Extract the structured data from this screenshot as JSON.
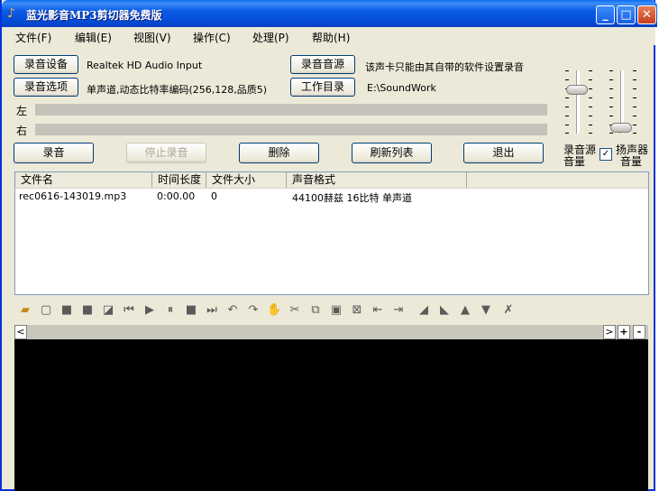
{
  "window": {
    "title": "蓝光影音MP3剪切器免费版",
    "controls": {
      "minimize": "_",
      "maximize": "□",
      "close": "✕"
    }
  },
  "menu": [
    "文件(F)",
    "编辑(E)",
    "视图(V)",
    "操作(C)",
    "处理(P)",
    "帮助(H)"
  ],
  "record_panel": {
    "device_button": "录音设备",
    "device_value": "Realtek HD Audio Input",
    "options_button": "录音选项",
    "options_value": "单声道,动态比特率编码(256,128,品质5)",
    "source_button": "录音音源",
    "source_value": "该声卡只能由其自带的软件设置录音",
    "workdir_button": "工作目录",
    "workdir_value": "E:\\SoundWork",
    "left_label": "左",
    "right_label": "右"
  },
  "actions": {
    "record": "录音",
    "stop": "停止录音",
    "delete": "删除",
    "refresh": "刷新列表",
    "exit": "退出"
  },
  "volume": {
    "source_label_1": "录音源",
    "source_label_2": "音量",
    "speaker_label_1": "扬声器",
    "speaker_label_2": "音量",
    "speaker_checked": "✓",
    "source_level": 0.7,
    "speaker_level": 0.1
  },
  "file_list": {
    "columns": [
      "文件名",
      "时间长度",
      "文件大小",
      "声音格式"
    ],
    "rows": [
      {
        "name": "rec0616-143019.mp3",
        "duration": "0:00.00",
        "size": "0",
        "format": "44100赫兹 16比特 单声道"
      }
    ]
  },
  "toolbar_icons": [
    "open-folder-icon",
    "new-file-icon",
    "save-icon",
    "save-as-icon",
    "export-icon",
    "skip-start-icon",
    "play-icon",
    "pause-icon",
    "stop-icon",
    "skip-end-icon",
    "undo-icon",
    "redo-icon",
    "hand-icon",
    "cut-icon",
    "copy-icon",
    "paste-icon",
    "mix-paste-icon",
    "trim-left-icon",
    "trim-right-icon",
    "fade-in-icon",
    "fade-out-icon",
    "volume-up-icon",
    "volume-down-icon",
    "clear-icon"
  ],
  "scrollbar": {
    "left": "<",
    "right": ">",
    "zoom_in": "+",
    "zoom_out": "-"
  }
}
